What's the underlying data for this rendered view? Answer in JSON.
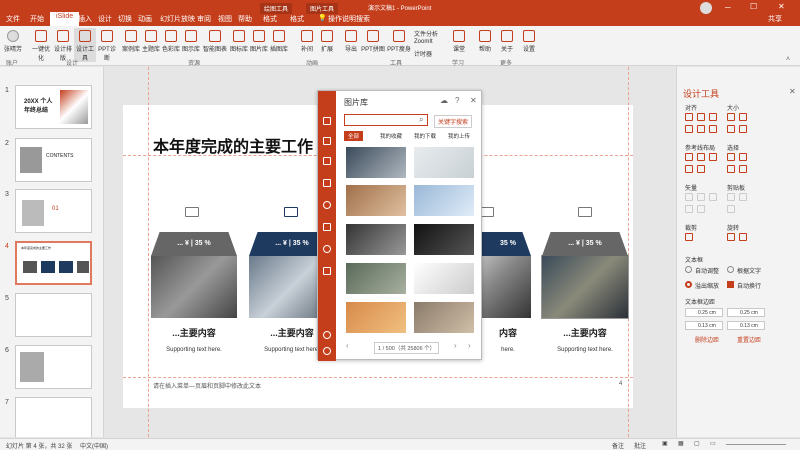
{
  "window": {
    "title": "演示文稿1 - PowerPoint",
    "context_tab_drawing": "绘图工具",
    "context_tab_picture": "图片工具",
    "user": "共享",
    "search_hint": "操作说明搜索"
  },
  "tabs": [
    "文件",
    "开始",
    "iSlide",
    "插入",
    "设计",
    "切换",
    "动画",
    "幻灯片放映",
    "审阅",
    "视图",
    "帮助",
    "格式",
    "格式"
  ],
  "ribbon": {
    "account": {
      "label": "张晴芳",
      "group": "账户"
    },
    "design_group": {
      "buttons": [
        "一键优化",
        "设计排版",
        "设计工具",
        "PPT诊断"
      ],
      "label": "设计"
    },
    "resource_group": {
      "buttons": [
        "案例库",
        "主题库",
        "色彩库",
        "图示库",
        "智能图表",
        "图标库",
        "图片库",
        "插图库"
      ],
      "label": "资源"
    },
    "extend_group": {
      "buttons": [
        "补间",
        "扩展"
      ],
      "label": "动画"
    },
    "tools_group": {
      "buttons": [
        "导出",
        "PPT拼图",
        "PPT瘦身",
        "文件分析",
        "ZoomIt",
        "计时器"
      ],
      "label": "工具"
    },
    "learn_group": {
      "buttons": [
        "课堂"
      ],
      "label": "学习"
    },
    "more_group": {
      "buttons": [
        "帮助",
        "关于",
        "设置"
      ],
      "label": "更多"
    }
  },
  "thumbnails": [
    {
      "num": "1",
      "label": "20XX 个人年终总结"
    },
    {
      "num": "2",
      "label": "CONTENTS"
    },
    {
      "num": "3",
      "label": "01"
    },
    {
      "num": "4",
      "label": "本年度完成的主要工作"
    },
    {
      "num": "5",
      "label": ""
    },
    {
      "num": "6",
      "label": ""
    },
    {
      "num": "7",
      "label": ""
    }
  ],
  "slide": {
    "title": "本年度完成的主要工作",
    "footer": "请在插入菜单—页眉和页脚中修改此文本",
    "page": "4",
    "cards": [
      {
        "header": "... ¥ | 35 %",
        "title": "...主要内容",
        "subtitle": "Supporting text here.",
        "color": "#666666"
      },
      {
        "header": "... ¥ | 35 %",
        "title": "...主要内容",
        "subtitle": "Supporting text here.",
        "color": "#1f3a5f"
      },
      {
        "header": "... ¥ | 35 %",
        "title": "...主要内容",
        "subtitle": "Supporting text here.",
        "color": "#1f3a5f"
      },
      {
        "header": "... ¥ | 35 %",
        "title": "...主要内容",
        "subtitle": "Supporting text here.",
        "color": "#666666"
      }
    ]
  },
  "image_library": {
    "title": "图片库",
    "search_placeholder": "",
    "search_button": "关键字搜索",
    "tabs": [
      "全部",
      "我的收藏",
      "我的下载",
      "我的上传"
    ],
    "pagination": "1 / 500（共 25806 个）"
  },
  "design_panel": {
    "title": "设计工具",
    "align": "对齐",
    "size": "大小",
    "guides": "参考线布局",
    "select": "选择",
    "rotate": "矢量",
    "clipboard": "剪贴板",
    "flip": "裁剪",
    "rotate2": "旋转",
    "textbox": "文本框",
    "autofit": "自动调整",
    "wrap": "根据文字",
    "overflow": "溢出缩放",
    "autowrap": "自动换行",
    "margins": "文本框边距",
    "m1": "0.25 cm",
    "m2": "0.25 cm",
    "m3": "0.13 cm",
    "m4": "0.13 cm",
    "delete_margins": "删除边距",
    "reset_margins": "重置边距"
  },
  "status": {
    "slide_info": "幻灯片 第 4 张，共 32 张",
    "lang": "中文(中国)",
    "notes": "备注",
    "comments": "批注"
  },
  "colors": {
    "accent": "#c43e1c"
  }
}
